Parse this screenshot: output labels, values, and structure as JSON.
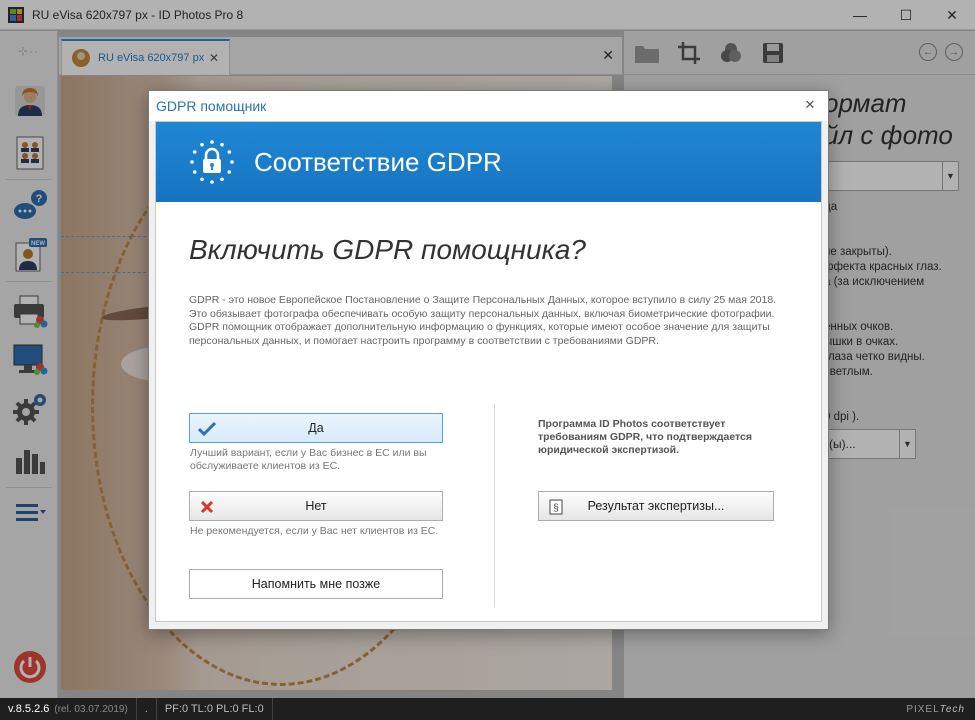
{
  "window": {
    "title": "RU eVisa 620x797 px - ID Photos Pro 8",
    "minimize": "—",
    "maximize": "☐",
    "close": "✕"
  },
  "sidebar": {
    "top_glyph": "⊹··",
    "items": [
      "person",
      "sheet",
      "help-chat",
      "new-portrait",
      "printer",
      "monitor",
      "settings",
      "chart",
      "menu",
      "power"
    ]
  },
  "tabs": [
    {
      "label": "RU eVisa 620x797 px",
      "close": "✕"
    }
  ],
  "tabbar_close": "✕",
  "right_panel": {
    "title_line1": "ормат",
    "title_line2": "йл с фото",
    "lines": [
      "да",
      "г.",
      " не закрыты).",
      "ффекта красных глаз.",
      "а (за исключением",
      "енных очков.",
      "ышки в очках.",
      " глаза четко видны.",
      " светлым.",
      "0 dpi ).",
      "(ы)..."
    ],
    "select_arrow": "▼"
  },
  "dialog": {
    "title": "GDPR помощник",
    "close": "✕",
    "banner_title": "Соответствие GDPR",
    "heading": "Включить GDPR помощника?",
    "description": [
      "GDPR - это новое Европейское Постановление о Защите Персональных Данных, которое вступило в силу 25 мая 2018. Это обязывает фотографа обеспечивать особую защиту персональных данных, включая биометрические фотографии.",
      "GDPR помощник отображает дополнительную информацию о функциях, которые имеют особое значение для защиты персональных данных, и помогает настроить программу в соответствии с требованиями GDPR."
    ],
    "yes_label": "Да",
    "yes_hint": "Лучший вариант, если у Вас бизнес в ЕС или вы обслуживаете клиентов из ЕС.",
    "no_label": "Нет",
    "no_hint": "Не рекомендуется, если у Вас нет клиентов из ЕС.",
    "later_label": "Напомнить мне позже",
    "compliance_text": "Программа ID Photos соответствует требованиям GDPR, что подтверждается юридической экспертизой.",
    "expert_label": "Результат экспертизы..."
  },
  "statusbar": {
    "version": "v.8.5.2.6",
    "release": "(rel. 03.07.2019)",
    "dot": ".",
    "counters": "PF:0 TL:0 PL:0 FL:0",
    "brand_a": "PIXEL",
    "brand_b": "Tech"
  },
  "colors": {
    "accent": "#1f87d4",
    "dialog_title": "#2a73b8",
    "yes_check": "#2a73b8",
    "no_cross": "#d63a2f"
  }
}
